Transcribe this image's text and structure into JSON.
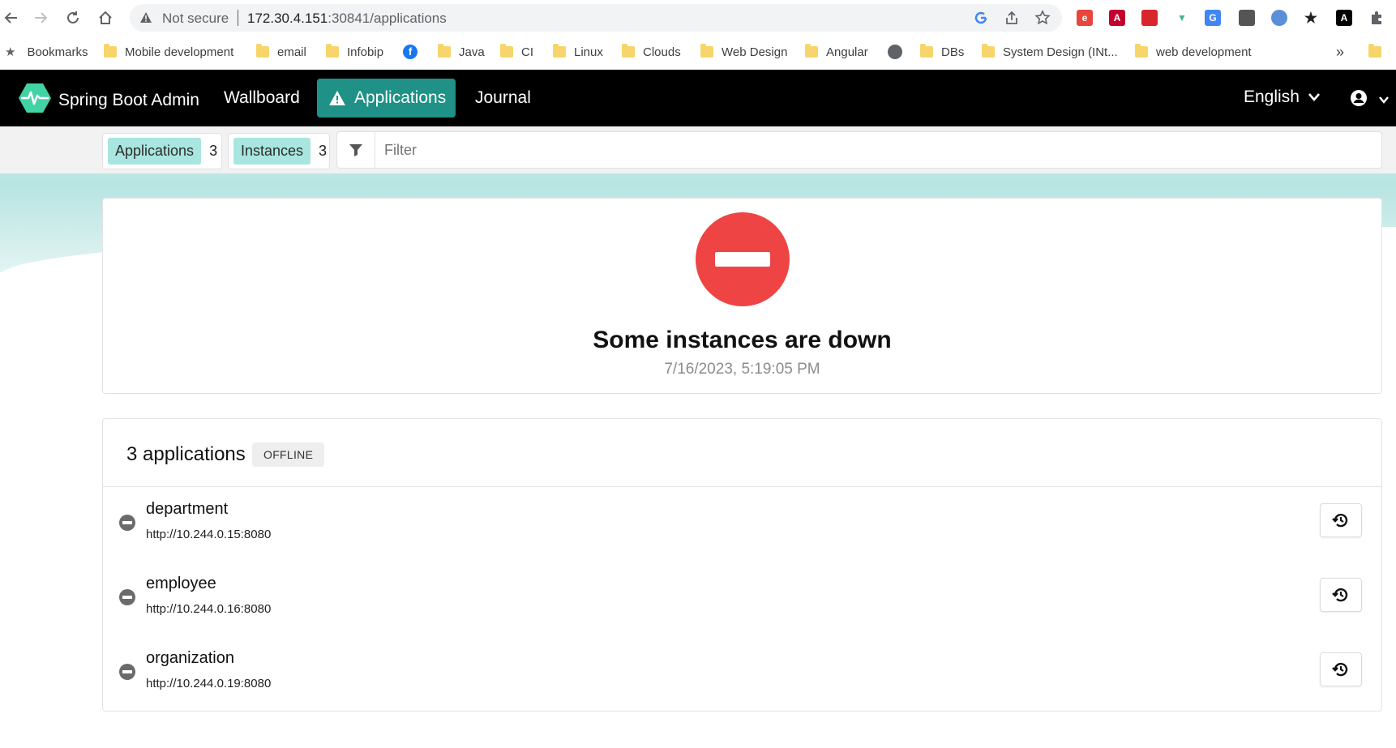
{
  "browser": {
    "security_label": "Not secure",
    "url_host": "172.30.4.151",
    "url_path": ":30841/applications",
    "bookmarks": [
      "Bookmarks",
      "Mobile development",
      "email",
      "Infobip",
      "Java",
      "CI",
      "Linux",
      "Clouds",
      "Web Design",
      "Angular",
      "DBs",
      "System Design (INt...",
      "web development"
    ],
    "overflow_label": "»"
  },
  "header": {
    "brand": "Spring Boot Admin",
    "nav": {
      "wallboard": "Wallboard",
      "applications": "Applications",
      "journal": "Journal"
    },
    "language": "English",
    "accent_color": "#1f9186"
  },
  "filters": {
    "applications_label": "Applications",
    "applications_count": "3",
    "instances_label": "Instances",
    "instances_count": "3",
    "filter_placeholder": "Filter"
  },
  "status": {
    "title": "Some instances are down",
    "timestamp": "7/16/2023, 5:19:05 PM",
    "color": "#ef4444"
  },
  "applications": {
    "count_label": "3 applications",
    "status_tag": "OFFLINE",
    "items": [
      {
        "name": "department",
        "url": "http://10.244.0.15:8080"
      },
      {
        "name": "employee",
        "url": "http://10.244.0.16:8080"
      },
      {
        "name": "organization",
        "url": "http://10.244.0.19:8080"
      }
    ]
  }
}
